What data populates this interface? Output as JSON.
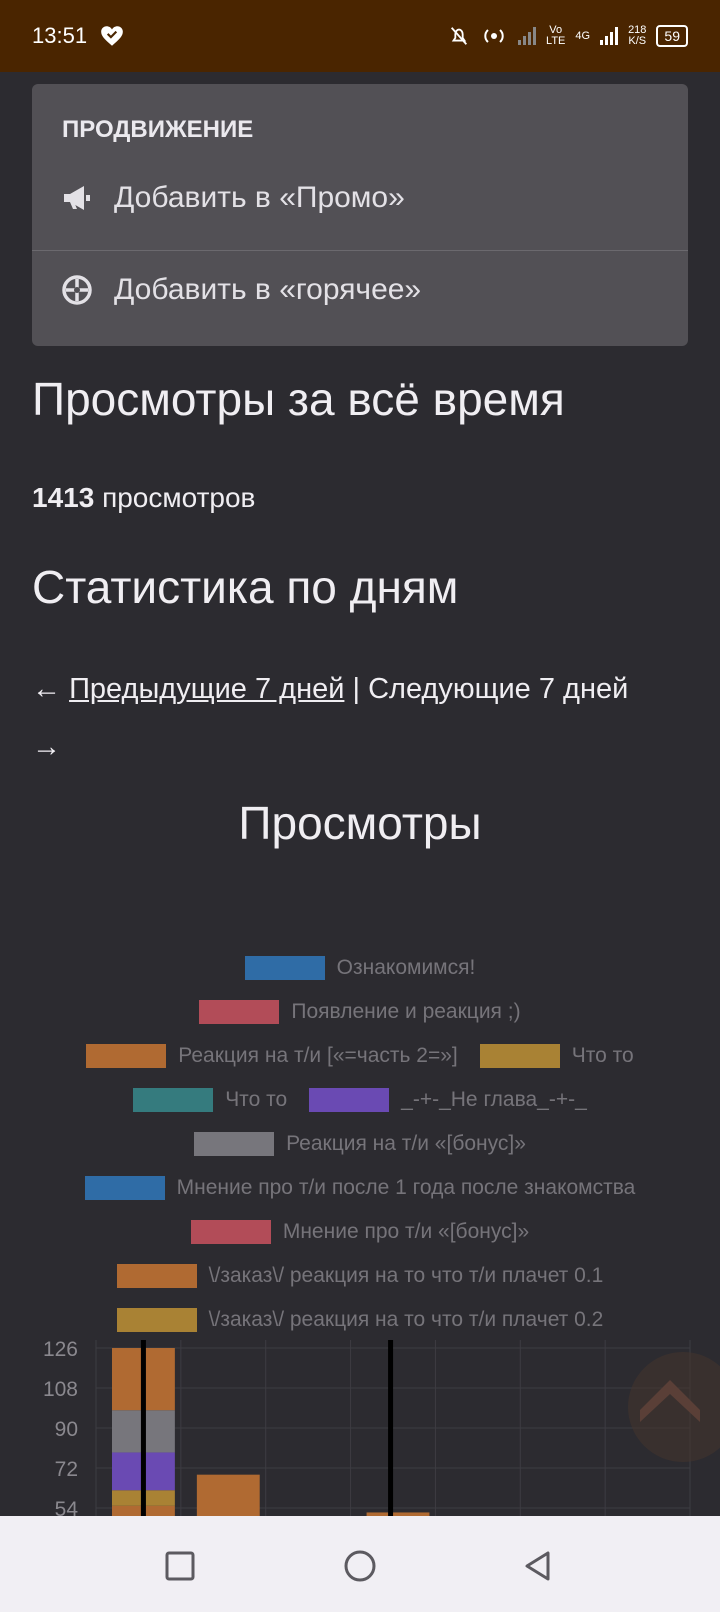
{
  "status_bar": {
    "time": "13:51",
    "network_labels": [
      "Vo",
      "LTE",
      "4G"
    ],
    "speed": "218",
    "speed_unit": "K/S",
    "battery": "59",
    "icons": [
      "heart-icon",
      "bell-off-icon",
      "hotspot-icon",
      "signal-icon",
      "signal-icon",
      "battery-icon"
    ]
  },
  "menu": {
    "header": "ПРОДВИЖЕНИЕ",
    "items": [
      {
        "label": "Добавить в «Промо»",
        "icon": "megaphone-icon"
      },
      {
        "label": "Добавить в «горячее»",
        "icon": "crosshair-icon"
      }
    ]
  },
  "views_total": {
    "heading": "Просмотры за всё время",
    "count": "1413",
    "count_suffix": " просмотров"
  },
  "stats": {
    "heading": "Статистика по дням",
    "prev_arrow": "← ",
    "prev_link": "Предыдущие 7 дней",
    "separator": " | ",
    "next_label": "Следующие 7 дней",
    "next_arrow": "→"
  },
  "chart_data": {
    "type": "bar",
    "title": "Просмотры",
    "stacked": true,
    "y_ticks": [
      126,
      108,
      90,
      72,
      54
    ],
    "legend": [
      {
        "name": "Ознакомимся!",
        "color": "#2f6ca6"
      },
      {
        "name": "Появление и реакция ;)",
        "color": "#b24c58"
      },
      {
        "name": "Реакция на т/и [«=часть 2=»]",
        "color": "#b06a32"
      },
      {
        "name": "Что то",
        "color": "#a98234"
      },
      {
        "name": "Что то",
        "color": "#357b7e"
      },
      {
        "name": "_-+-_Не глава_-+-_",
        "color": "#6a4ab3"
      },
      {
        "name": "Реакция на т/и «[бонус]»",
        "color": "#77767c"
      },
      {
        "name": "Мнение про т/и после 1 года после знакомства",
        "color": "#2f6ca6"
      },
      {
        "name": "Мнение про т/и «[бонус]»",
        "color": "#b24c58"
      },
      {
        "name": "\\/заказ\\/ реакция на то что т/и плачет 0.1",
        "color": "#b06a32"
      },
      {
        "name": "\\/заказ\\/ реакция на то что т/и плачет 0.2",
        "color": "#a98234"
      }
    ],
    "legend_rows": [
      [
        0
      ],
      [
        1
      ],
      [
        2,
        3
      ],
      [
        4,
        5
      ],
      [
        6
      ],
      [
        7
      ],
      [
        8
      ],
      [
        9
      ],
      [
        10
      ]
    ],
    "y_min": 45,
    "y_max": 126,
    "visible_bars": [
      {
        "day": 0,
        "segments": [
          {
            "series": 1,
            "from": 45,
            "to": 50
          },
          {
            "series": 2,
            "from": 50,
            "to": 55
          },
          {
            "series": 3,
            "from": 55,
            "to": 62
          },
          {
            "series": 5,
            "from": 62,
            "to": 79
          },
          {
            "series": 6,
            "from": 79,
            "to": 98
          },
          {
            "series": 2,
            "from": 98,
            "to": 126
          }
        ]
      },
      {
        "day": 1,
        "segments": [
          {
            "series": 6,
            "from": 45,
            "to": 50
          },
          {
            "series": 2,
            "from": 50,
            "to": 69
          }
        ]
      },
      {
        "day": 3,
        "segments": [
          {
            "series": 2,
            "from": 45,
            "to": 52
          }
        ]
      }
    ]
  },
  "nav_bar": {
    "icons": [
      "square-icon",
      "circle-icon",
      "back-icon"
    ]
  }
}
